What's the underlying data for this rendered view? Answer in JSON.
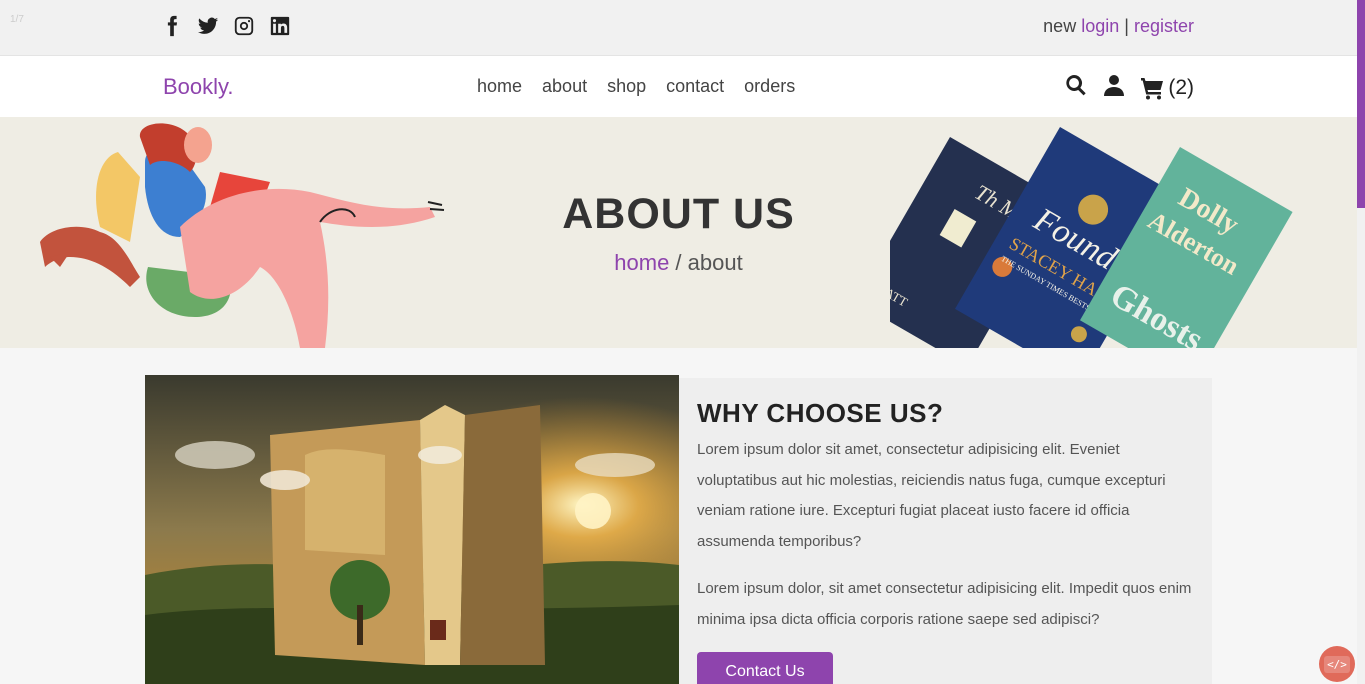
{
  "slide_counter": "1/7",
  "header": {
    "social_icons": [
      "facebook-icon",
      "twitter-icon",
      "instagram-icon",
      "linkedin-icon"
    ],
    "auth_prefix": "new",
    "login": "login",
    "separator": "|",
    "register": "register"
  },
  "nav": {
    "logo": "Bookly.",
    "links": [
      "home",
      "about",
      "shop",
      "contact",
      "orders"
    ],
    "cart_count": "(2)"
  },
  "banner": {
    "title": "ABOUT US",
    "breadcrumb_home": "home",
    "breadcrumb_sep": " / ",
    "breadcrumb_current": "about",
    "book_covers": [
      "The Midnight Library Matt Haig",
      "The Foundling Stacey Halls The Sunday Times Bestseller",
      "Dolly Alderton Ghosts"
    ]
  },
  "about": {
    "heading": "WHY CHOOSE US?",
    "paragraph1": "Lorem ipsum dolor sit amet, consectetur adipisicing elit. Eveniet voluptatibus aut hic molestias, reiciendis natus fuga, cumque excepturi veniam ratione iure. Excepturi fugiat placeat iusto facere id officia assumenda temporibus?",
    "paragraph2": "Lorem ipsum dolor, sit amet consectetur adipisicing elit. Impedit quos enim minima ipsa dicta officia corporis ratione saepe sed adipisci?",
    "button": "Contact Us"
  },
  "badge": "</>",
  "colors": {
    "accent": "#8e44ad",
    "banner_bg": "#efede4",
    "topbar_bg": "#f1f1f1"
  }
}
